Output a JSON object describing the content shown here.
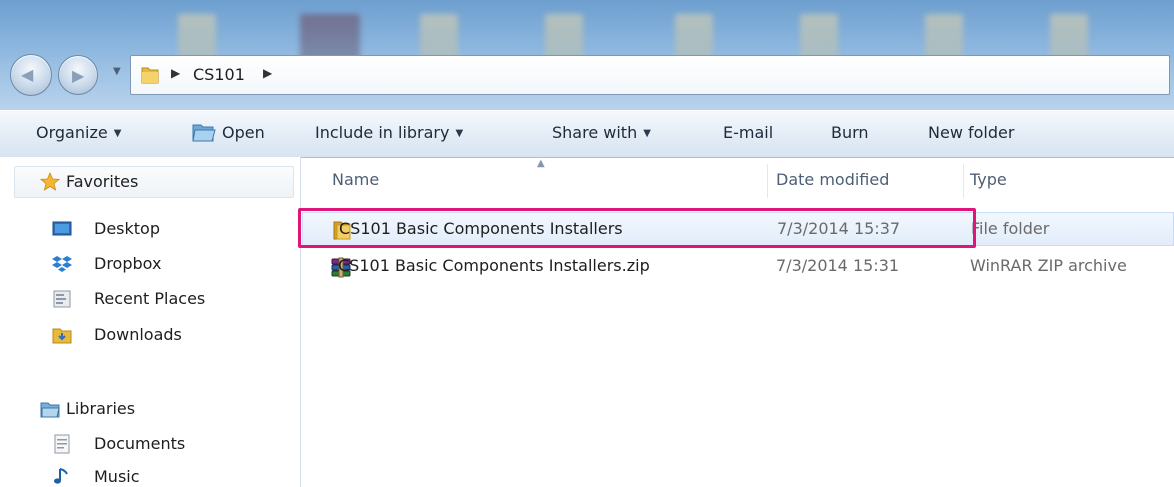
{
  "address_bar": {
    "path": [
      "CS101"
    ]
  },
  "toolbar": {
    "organize": "Organize",
    "open": "Open",
    "include_in_library": "Include in library",
    "share_with": "Share with",
    "email": "E-mail",
    "burn": "Burn",
    "new_folder": "New folder"
  },
  "nav_pane": {
    "favorites": {
      "label": "Favorites",
      "items": [
        "Desktop",
        "Dropbox",
        "Recent Places",
        "Downloads"
      ]
    },
    "libraries": {
      "label": "Libraries",
      "items": [
        "Documents",
        "Music"
      ]
    }
  },
  "file_list": {
    "columns": [
      "Name",
      "Date modified",
      "Type"
    ],
    "rows": [
      {
        "name": "CS101 Basic Components Installers",
        "date": "7/3/2014 15:37",
        "type": "File folder",
        "icon": "folder-icon",
        "selected": true
      },
      {
        "name": "CS101 Basic Components Installers.zip",
        "date": "7/3/2014 15:31",
        "type": "WinRAR ZIP archive",
        "icon": "winrar-icon",
        "selected": false
      }
    ]
  },
  "colors": {
    "highlight": "#e0157b",
    "selection": "#e2edfa"
  }
}
